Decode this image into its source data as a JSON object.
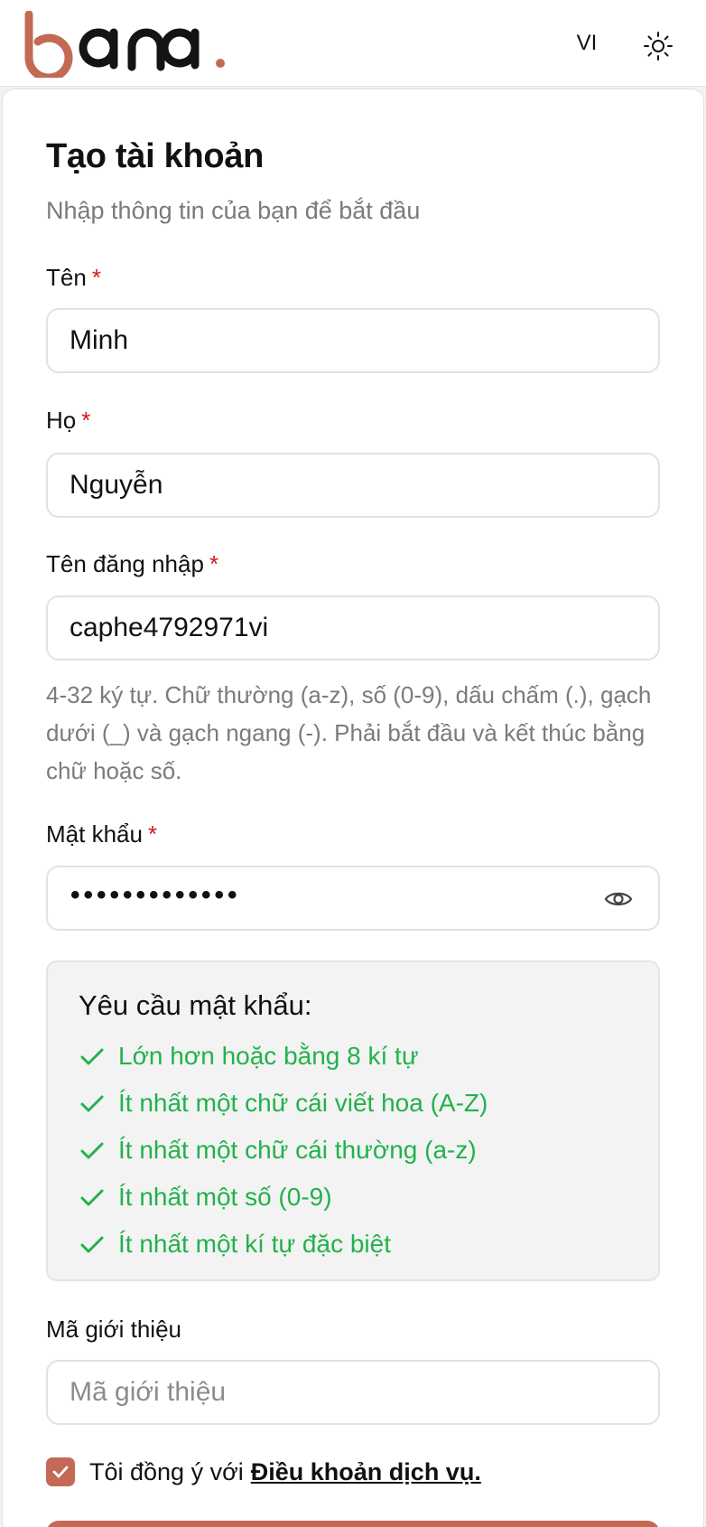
{
  "header": {
    "logo_text": "bana.",
    "language": "VI",
    "theme_icon": "sun-icon"
  },
  "form": {
    "title": "Tạo tài khoản",
    "subtitle": "Nhập thông tin của bạn để bắt đầu",
    "required_marker": "*",
    "first_name": {
      "label": "Tên",
      "value": "Minh"
    },
    "last_name": {
      "label": "Họ",
      "value": "Nguyễn"
    },
    "username": {
      "label": "Tên đăng nhập",
      "value": "caphe4792971vi",
      "hint": "4-32 ký tự. Chữ thường (a-z), số (0-9), dấu chấm (.), gạch dưới (_) và gạch ngang (-). Phải bắt đầu và kết thúc bằng chữ hoặc số."
    },
    "password": {
      "label": "Mật khẩu",
      "masked_value": "•••••••••••••",
      "toggle_icon": "eye-icon"
    },
    "password_requirements": {
      "title": "Yêu cầu mật khẩu:",
      "items": [
        {
          "text": "Lớn hơn hoặc bằng 8 kí tự",
          "met": true
        },
        {
          "text": "Ít nhất một chữ cái viết hoa (A-Z)",
          "met": true
        },
        {
          "text": "Ít nhất một chữ cái thường (a-z)",
          "met": true
        },
        {
          "text": "Ít nhất một số (0-9)",
          "met": true
        },
        {
          "text": "Ít nhất một kí tự đặc biệt",
          "met": true
        }
      ]
    },
    "referral": {
      "label": "Mã giới thiệu",
      "placeholder": "Mã giới thiệu",
      "value": ""
    },
    "terms": {
      "checked": true,
      "text": "Tôi đồng ý với",
      "link": "Điều khoản dịch vụ."
    }
  },
  "colors": {
    "brand": "#c26a55",
    "logo_dark": "#141414",
    "required": "#d11a1a",
    "success": "#22b24c",
    "muted_text": "#7a7a7a"
  }
}
